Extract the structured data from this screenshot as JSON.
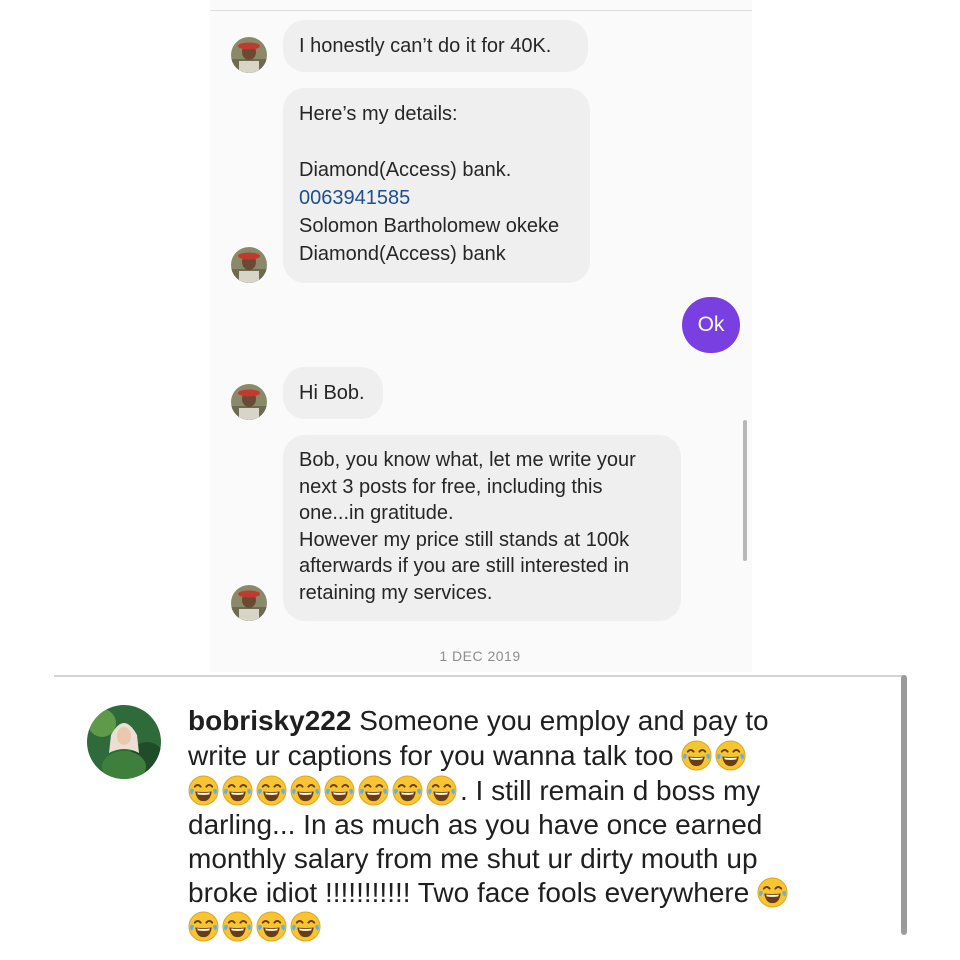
{
  "chat": {
    "messages": [
      {
        "sender": "other",
        "lines": [
          "I honestly can’t do it for 40K."
        ]
      },
      {
        "sender": "other",
        "lines": [
          "Here’s my details:",
          "",
          "Diamond(Access) bank.",
          "0063941585",
          "Solomon Bartholomew okeke",
          "Diamond(Access) bank"
        ]
      },
      {
        "sender": "me",
        "lines": [
          "Ok"
        ]
      },
      {
        "sender": "other",
        "lines": [
          "Hi Bob."
        ]
      },
      {
        "sender": "other",
        "lines": [
          "Bob, you know what, let me write your",
          "next 3 posts for free, including this",
          "one...in gratitude.",
          "However my price still stands at 100k",
          "afterwards if you are still interested in",
          "retaining my services."
        ]
      }
    ],
    "date_separator": "1 DEC 2019",
    "colors": {
      "sent_bubble": "#7a3fe0",
      "received_bubble": "#efefef",
      "link": "#1f4f8f"
    }
  },
  "comment": {
    "username": "bobrisky222",
    "line1_text": "Someone you employ and pay to",
    "line2_text": "write ur captions for you wanna talk too",
    "line3_text": ". I still remain d boss my",
    "line4_text": "darling... In as much as you have once earned",
    "line5_text": "monthly salary from me shut ur dirty mouth up",
    "line6_text": "broke idiot !!!!!!!!!!! Two face fools everywhere",
    "emoji": "face-with-tears-of-joy-icon",
    "emoji_counts": {
      "line2": 2,
      "line3": 8,
      "line6": 1,
      "line7": 4
    }
  }
}
